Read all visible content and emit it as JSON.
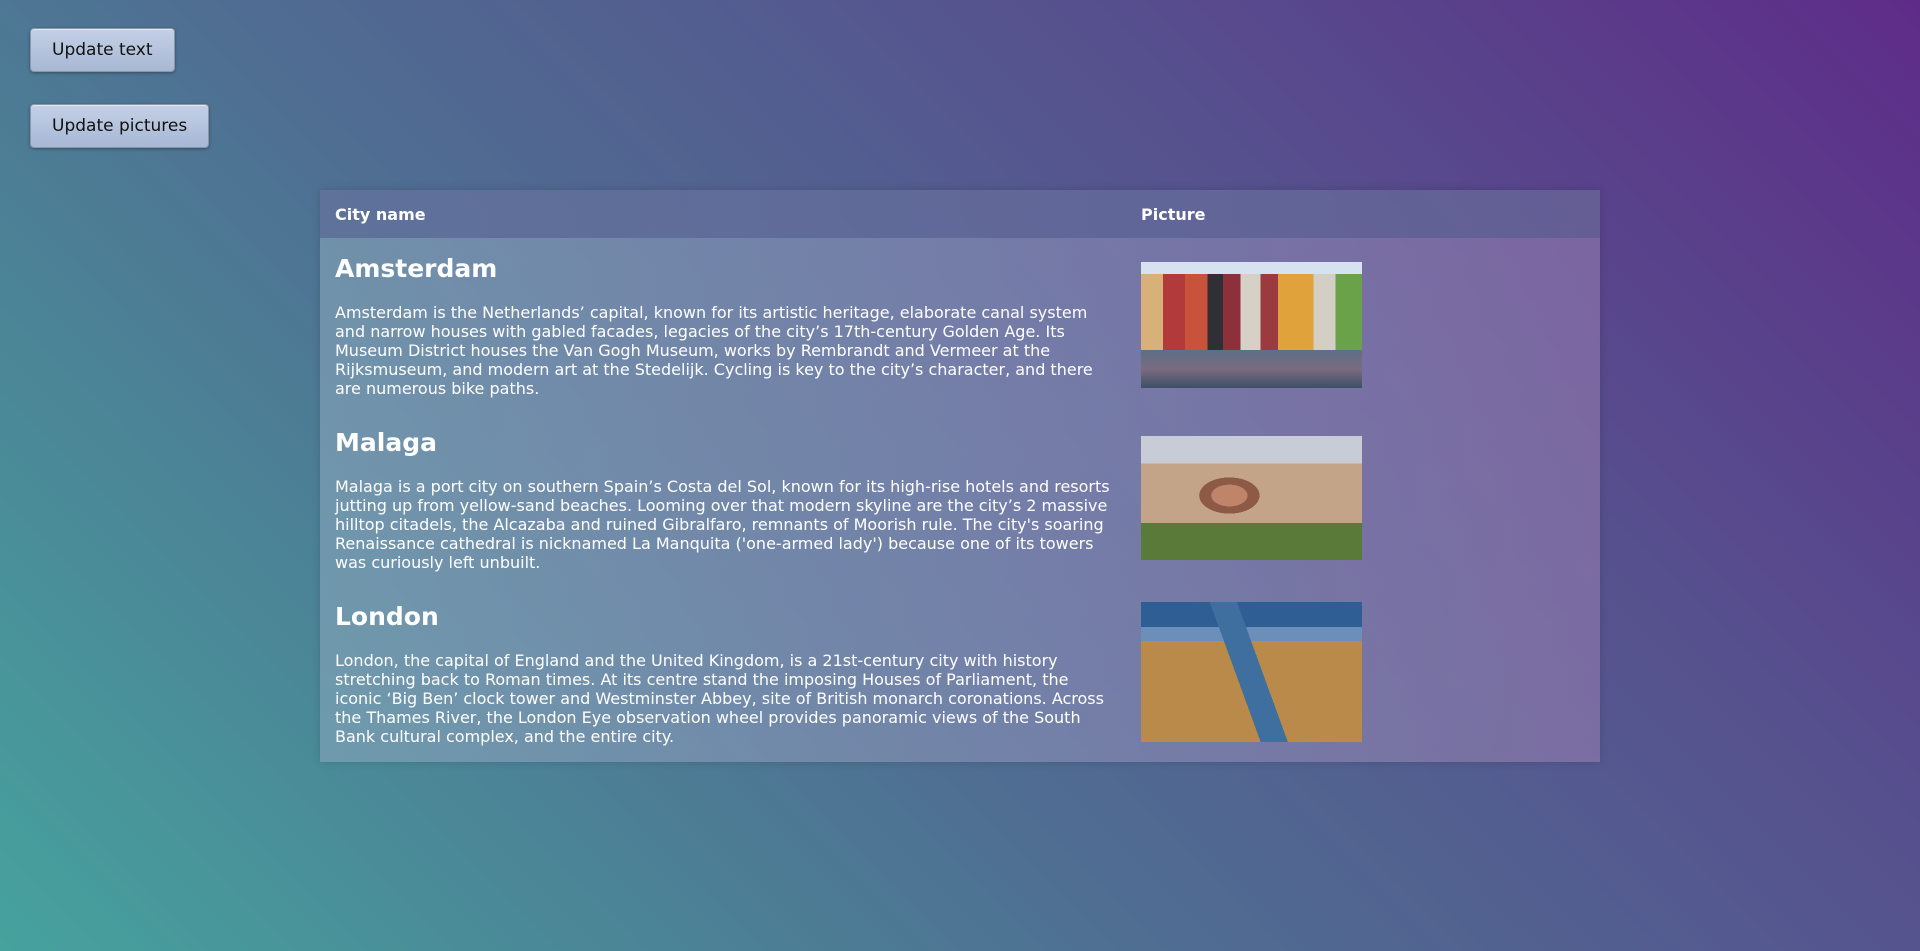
{
  "buttons": {
    "update_text": "Update text",
    "update_pictures": "Update pictures"
  },
  "table": {
    "headers": {
      "city": "City name",
      "picture": "Picture"
    },
    "rows": [
      {
        "name": "Amsterdam",
        "description": "Amsterdam is the Netherlands’ capital, known for its artistic heritage, elaborate canal system and narrow houses with gabled facades, legacies of the city’s 17th-century Golden Age. Its Museum District houses the Van Gogh Museum, works by Rembrandt and Vermeer at the Rijksmuseum, and modern art at the Stedelijk. Cycling is key to the city’s character, and there are numerous bike paths.",
        "picture": "amsterdam-canal-houses-photo"
      },
      {
        "name": "Malaga",
        "description": "Malaga is a port city on southern Spain’s Costa del Sol, known for its high-rise hotels and resorts jutting up from yellow-sand beaches. Looming over that modern skyline are the city’s 2 massive hilltop citadels, the Alcazaba and ruined Gibralfaro, remnants of Moorish rule. The city's soaring Renaissance cathedral is nicknamed La Manquita ('one-armed lady') because one of its towers was curiously left unbuilt.",
        "picture": "malaga-bullring-photo"
      },
      {
        "name": "London",
        "description": "London, the capital of England and the United Kingdom, is a 21st-century city with history stretching back to Roman times. At its centre stand the imposing Houses of Parliament, the iconic ‘Big Ben’ clock tower and Westminster Abbey, site of British monarch coronations. Across the Thames River, the London Eye observation wheel provides panoramic views of the South Bank cultural complex, and the entire city.",
        "picture": "london-thames-aerial-photo"
      }
    ]
  }
}
